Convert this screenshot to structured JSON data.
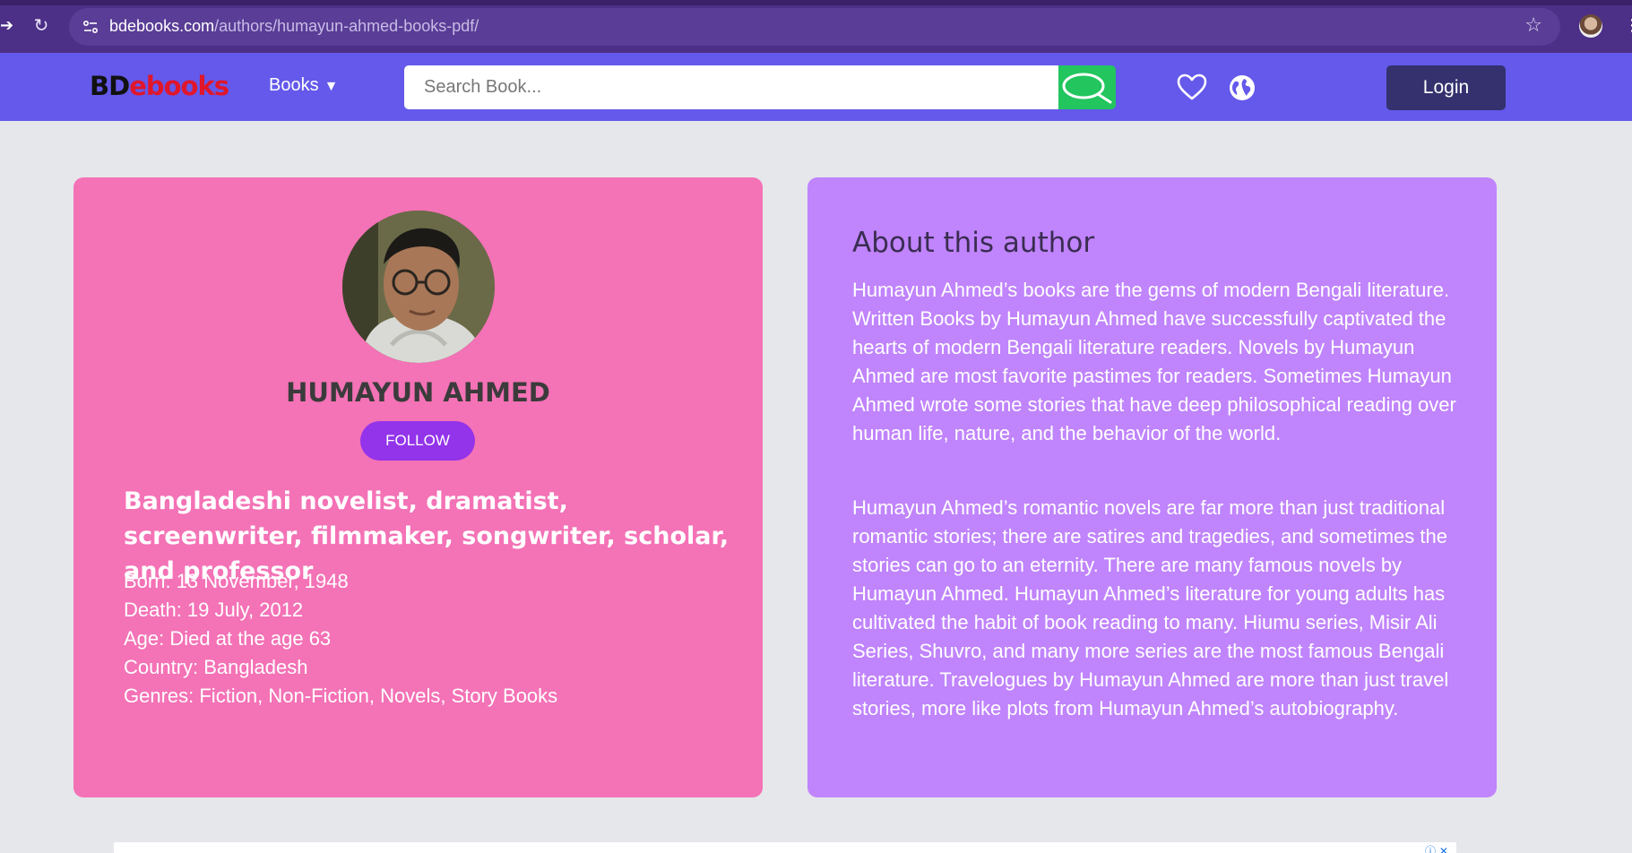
{
  "browser": {
    "url_host": "bdebooks.com",
    "url_path": "/authors/humayun-ahmed-books-pdf/"
  },
  "header": {
    "logo_part1": "BD",
    "logo_part2": "ebooks",
    "books_menu": "Books",
    "search_placeholder": "Search Book...",
    "login_label": "Login"
  },
  "author": {
    "name": "HUMAYUN AHMED",
    "follow_label": "FOLLOW",
    "headline": "Bangladeshi novelist, dramatist, screenwriter, filmmaker, songwriter, scholar, and professor",
    "facts": [
      "Born: 13 November, 1948",
      "Death: 19 July, 2012",
      "Age: Died at the age 63",
      "Country: Bangladesh",
      "Genres: Fiction, Non-Fiction, Novels, Story Books"
    ]
  },
  "about": {
    "title": "About this author",
    "paragraph1": "Humayun Ahmed’s books are the gems of modern Bengali literature. Written Books by Humayun Ahmed have successfully captivated the hearts of modern Bengali literature readers. Novels by Humayun Ahmed are most favorite pastimes for readers. Sometimes Humayun Ahmed wrote some stories that have deep philosophical reading over human life, nature, and the behavior of the world.",
    "paragraph2": "Humayun Ahmed’s romantic novels are far more than just traditional romantic stories; there are satires and tragedies, and sometimes the stories can go to an eternity. There are many famous novels by Humayun Ahmed. Humayun Ahmed’s literature for young adults has cultivated the habit of book reading to many. Hiumu series, Misir Ali Series, Shuvro, and many more series are the most famous Bengali literature. Travelogues by Humayun Ahmed are more than just travel stories, more like plots from Humayun Ahmed’s autobiography."
  },
  "colors": {
    "header_bg": "#6459ea",
    "left_card": "#f472b6",
    "right_card": "#c084fc",
    "follow_btn": "#9333ea",
    "search_btn": "#22c55e",
    "login_btn": "#34316e"
  }
}
